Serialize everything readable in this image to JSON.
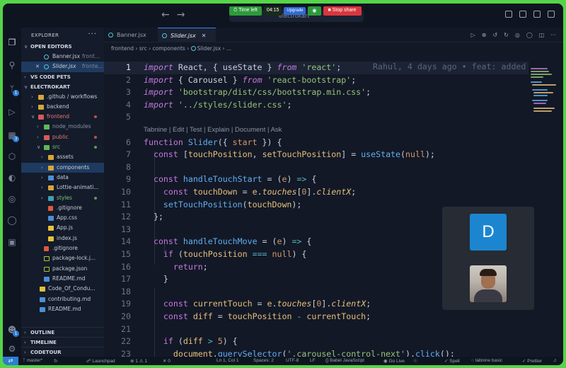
{
  "share": {
    "time_left_label": "Time left",
    "time_left_value": "04:15",
    "upgrade": "Upgrade",
    "stop_share": "Stop share"
  },
  "titlebar": {
    "command_center": "electrokart"
  },
  "sidebar": {
    "title": "EXPLORER",
    "open_editors": "OPEN EDITORS",
    "open_files": [
      {
        "name": "Banner.jsx",
        "hint": "front..."
      },
      {
        "name": "Slider.jsx",
        "hint": "fronte..."
      }
    ],
    "vs_code_pets": "VS CODE PETS",
    "project": "ELECTROKART",
    "tree": [
      {
        "label": ".github / workflows"
      },
      {
        "label": "backend"
      },
      {
        "label": "frontend"
      },
      {
        "label": "node_modules"
      },
      {
        "label": "public"
      },
      {
        "label": "src"
      },
      {
        "label": "assets"
      },
      {
        "label": "components"
      },
      {
        "label": "data"
      },
      {
        "label": "Lottie-animati..."
      },
      {
        "label": "styles"
      },
      {
        "label": ".gitignore"
      },
      {
        "label": "App.css"
      },
      {
        "label": "App.js"
      },
      {
        "label": "index.js"
      },
      {
        "label": ".gitignore"
      },
      {
        "label": "package-lock.j..."
      },
      {
        "label": "package.json"
      },
      {
        "label": "README.md"
      },
      {
        "label": "Code_Of_Condu..."
      },
      {
        "label": "contributing.md"
      },
      {
        "label": "README.md"
      }
    ],
    "bottom": [
      "OUTLINE",
      "TIMELINE",
      "CODETOUR"
    ]
  },
  "tabs": [
    {
      "name": "Banner.jsx"
    },
    {
      "name": "Slider.jsx"
    }
  ],
  "breadcrumb": [
    "frontend",
    "src",
    "components",
    "Slider.jsx",
    "..."
  ],
  "editor": {
    "blame": "Rahul, 4 days ago • feat: added",
    "codelens": "Tabnine | Edit | Test | Explain | Document | Ask",
    "line_numbers": [
      "1",
      "2",
      "3",
      "4",
      "5",
      "6",
      "7",
      "8",
      "9",
      "10",
      "11",
      "12",
      "13",
      "14",
      "15",
      "16",
      "17",
      "18",
      "19",
      "20",
      "21",
      "22",
      "23"
    ]
  },
  "video": {
    "participant_initial": "D"
  },
  "statusbar": {
    "branch": "master*",
    "launchpad": "Launchpad",
    "errors": "1",
    "warnings": "1",
    "ports": "0",
    "position": "Ln 1, Col 1",
    "spaces": "Spaces: 2",
    "encoding": "UTF-8",
    "eol": "LF",
    "language": "Babel JavaScript",
    "golive": "Go Live",
    "spell": "Spell",
    "tabnine": "tabnine basic",
    "prettier": "Prettier"
  }
}
